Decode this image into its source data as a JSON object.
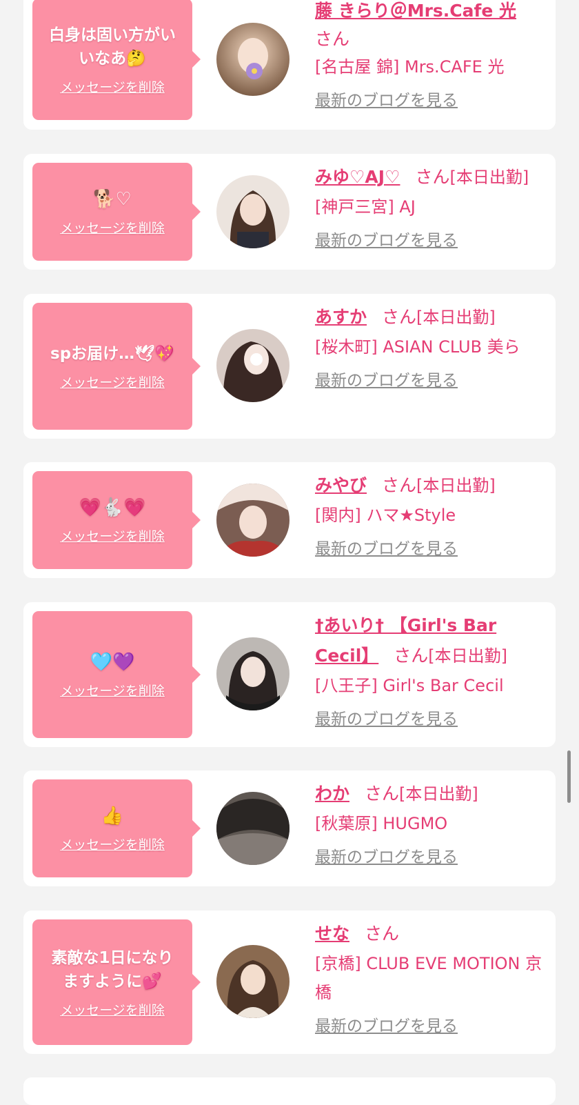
{
  "delete_label": "メッセージを削除",
  "blog_label": "最新のブログを見る",
  "san_label": "さん",
  "items": [
    {
      "message": "白身は固い方がい\nいなあ🤔",
      "name": "藤 きらり＠Mrs.Cafe 光",
      "status": "",
      "shop": "[名古屋 錦] Mrs.CAFE 光",
      "avatar_colors": [
        "#d9b08c",
        "#6a4a33"
      ]
    },
    {
      "message": "🐕♡",
      "name": "みゆ♡AJ♡",
      "status": "[本日出勤]",
      "shop": "[神戸三宮] AJ",
      "avatar_colors": [
        "#e8ddd6",
        "#3a2a22"
      ]
    },
    {
      "message": "spお届け…🕊💖",
      "name": "あすか",
      "status": "[本日出勤]",
      "shop": "[桜木町] ASIAN CLUB 美ら",
      "avatar_colors": [
        "#d7c8c2",
        "#2b1f1c"
      ]
    },
    {
      "message": "💗🐇💗",
      "name": "みやび",
      "status": "[本日出勤]",
      "shop": "[関内] ハマ★Style",
      "avatar_colors": [
        "#b4342f",
        "#f1e4dd"
      ]
    },
    {
      "message": "🩵💜",
      "name": "†あいり† 【Girl's Bar Cecil】",
      "status": "[本日出勤]",
      "shop": "[八王子] Girl's Bar Cecil",
      "avatar_colors": [
        "#b7b3b0",
        "#1e1a19"
      ]
    },
    {
      "message": "👍",
      "name": "わか",
      "status": "[本日出勤]",
      "shop": "[秋葉原] HUGMO",
      "avatar_colors": [
        "#6a625d",
        "#1f1c1a"
      ]
    },
    {
      "message": "素敵な1日になり\nますように💕",
      "name": "せな",
      "status": "",
      "shop": "[京橋] CLUB EVE MOTION 京橋",
      "avatar_colors": [
        "#c69b74",
        "#3c2d24"
      ]
    }
  ]
}
